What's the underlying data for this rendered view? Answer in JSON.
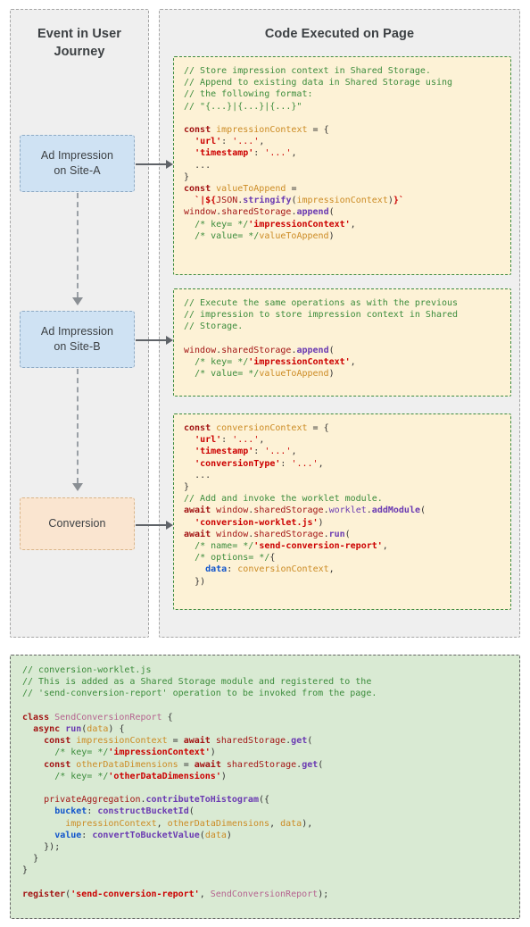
{
  "diagram": {
    "left_panel": {
      "title": "Event in User Journey"
    },
    "right_panel": {
      "title": "Code Executed on Page"
    },
    "flow_boxes": [
      {
        "id": "ad-impression-site-a",
        "label": "Ad Impression on Site-A",
        "line1": "Ad Impression",
        "line2": "on Site-A",
        "color": "#cfe2f3"
      },
      {
        "id": "ad-impression-site-b",
        "label": "Ad Impression on Site-B",
        "line1": "Ad Impression",
        "line2": "on Site-B",
        "color": "#cfe2f3"
      },
      {
        "id": "conversion",
        "label": "Conversion",
        "line1": "Conversion",
        "line2": "",
        "color": "#fae5d0"
      }
    ],
    "code_blocks": [
      {
        "id": "code-site-a",
        "background": "#fdf2d6",
        "border": "#3d8b40",
        "lines": [
          "// Store impression context in Shared Storage.",
          "// Append to existing data in Shared Storage using",
          "// the following format:",
          "// \"{...}|{...}|{...}\"",
          "",
          "const impressionContext = {",
          "  'url': '...',",
          "  'timestamp': '...',",
          "  ...",
          "}",
          "const valueToAppend =",
          "  `|${JSON.stringify(impressionContext)}`",
          "window.sharedStorage.append(",
          "  /* key= */'impressionContext',",
          "  /* value= */valueToAppend)"
        ]
      },
      {
        "id": "code-site-b",
        "background": "#fdf2d6",
        "border": "#3d8b40",
        "lines": [
          "// Execute the same operations as with the previous",
          "// impression to store impression context in Shared",
          "// Storage.",
          "",
          "window.sharedStorage.append(",
          "  /* key= */'impressionContext',",
          "  /* value= */valueToAppend)"
        ]
      },
      {
        "id": "code-conversion",
        "background": "#fdf2d6",
        "border": "#3d8b40",
        "lines": [
          "const conversionContext = {",
          "  'url': '...',",
          "  'timestamp': '...',",
          "  'conversionType': '...',",
          "  ...",
          "}",
          "// Add and invoke the worklet module.",
          "await window.sharedStorage.worklet.addModule(",
          "  'conversion-worklet.js')",
          "await window.sharedStorage.run(",
          "  /* name= */'send-conversion-report',",
          "  /* options= */{",
          "    data: conversionContext,",
          "  })"
        ]
      },
      {
        "id": "code-worklet",
        "background": "#d9ead3",
        "border": "#666666",
        "lines": [
          "// conversion-worklet.js",
          "// This is added as a Shared Storage module and registered to the",
          "// 'send-conversion-report' operation to be invoked from the page.",
          "",
          "class SendConversionReport {",
          "  async run(data) {",
          "    const impressionContext = await sharedStorage.get(",
          "      /* key= */'impressionContext')",
          "    const otherDataDimensions = await sharedStorage.get(",
          "      /* key= */'otherDataDimensions')",
          "",
          "    privateAggregation.contributeToHistogram({",
          "      bucket: constructBucketId(",
          "        impressionContext, otherDataDimensions, data),",
          "      value: convertToBucketValue(data)",
          "    });",
          "  }",
          "}",
          "",
          "register('send-conversion-report', SendConversionReport);"
        ]
      }
    ]
  }
}
